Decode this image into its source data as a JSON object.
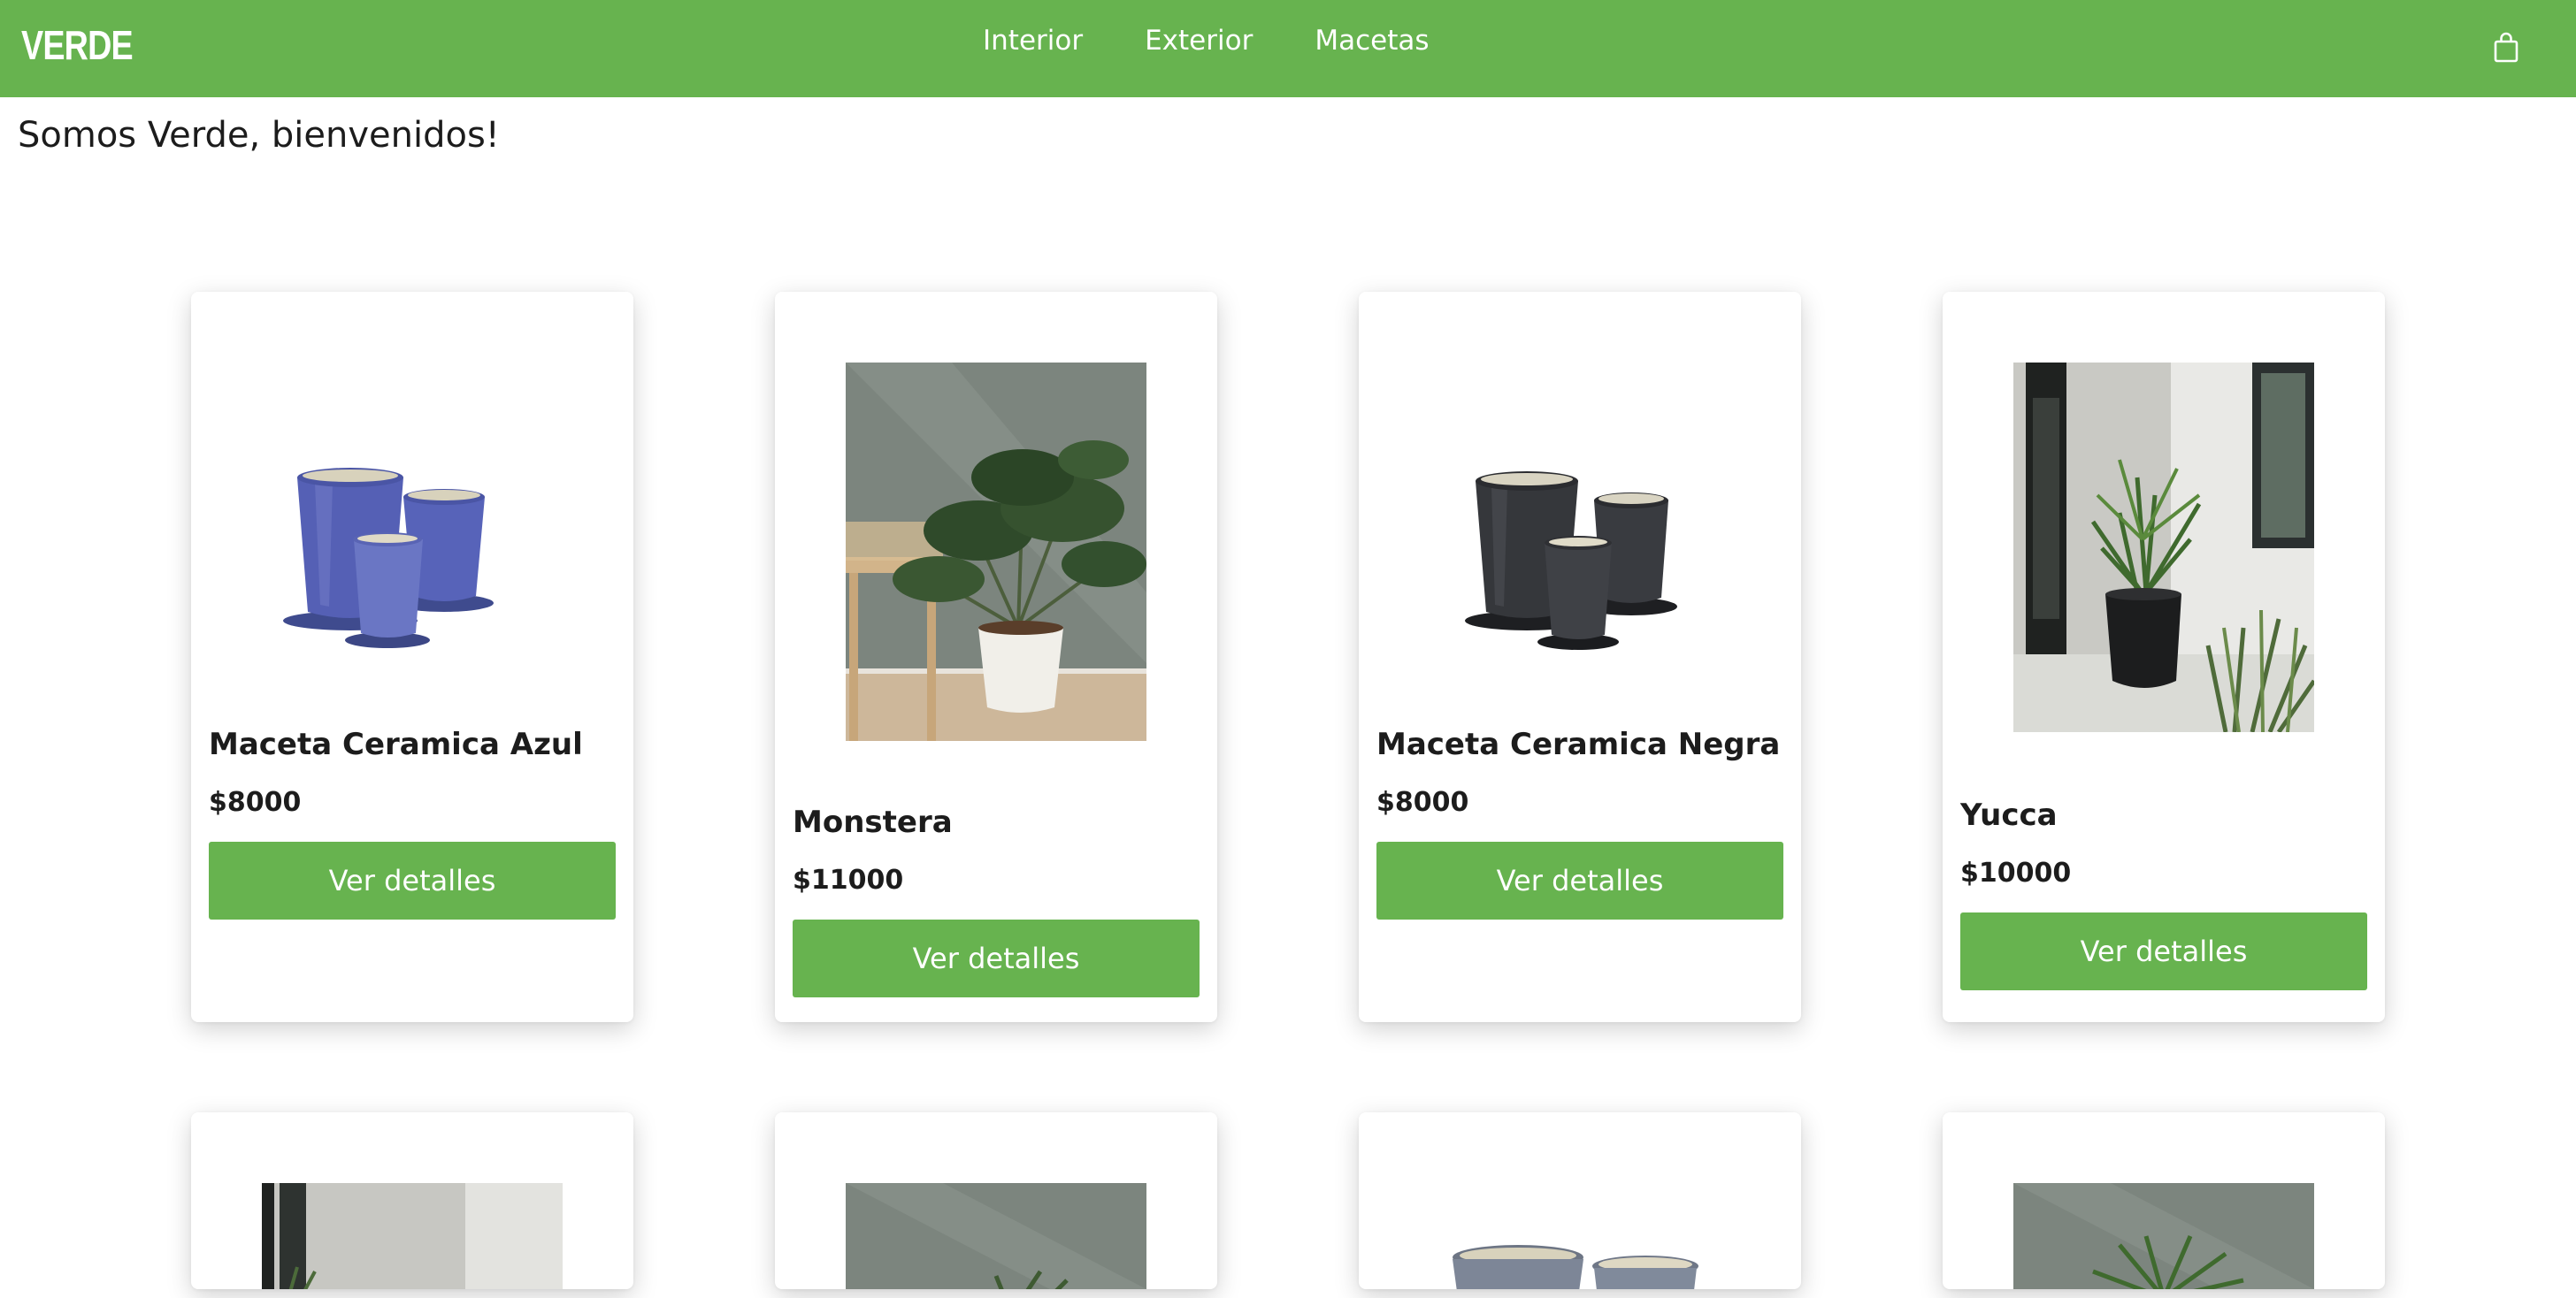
{
  "navbar": {
    "brand": "VERDE",
    "links": [
      "Interior",
      "Exterior",
      "Macetas"
    ],
    "cart_icon": "shopping-bag-icon",
    "color": "#67b34f"
  },
  "welcome": "Somos Verde, bienvenidos!",
  "products": [
    {
      "name": "Maceta Ceramica Azul",
      "price": "$8000",
      "button": "Ver detalles",
      "image": "blue-ceramic-pots"
    },
    {
      "name": "Monstera",
      "price": "$11000",
      "button": "Ver detalles",
      "image": "monstera-plant"
    },
    {
      "name": "Maceta Ceramica Negra",
      "price": "$8000",
      "button": "Ver detalles",
      "image": "black-ceramic-pots"
    },
    {
      "name": "Yucca",
      "price": "$10000",
      "button": "Ver detalles",
      "image": "yucca-plant"
    }
  ],
  "second_row_images": [
    "plant-by-window",
    "plant-gray-wall",
    "gray-ceramic-pots",
    "palm-plant"
  ]
}
